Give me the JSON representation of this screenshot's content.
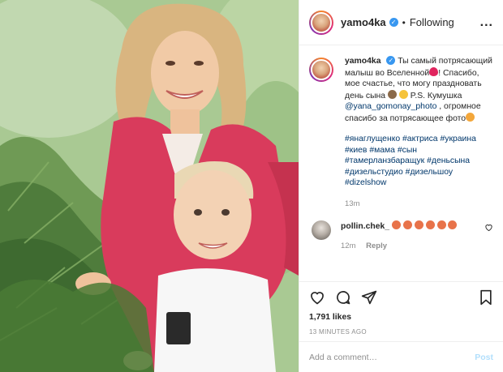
{
  "post": {
    "photo_alt": "",
    "header": {
      "username": "yamo4ka",
      "separator": "•",
      "follow_status": "Following",
      "more": "..."
    },
    "caption": {
      "username": "yamo4ka",
      "line1": "Ты самый потрясающий малыш во Вселенной",
      "line1_end": "!",
      "line2": "Спасибо, мое счастье, что могу праздновать день сына",
      "line2_end": " P.S. Кумушка ",
      "mention": "@yana_gomonay_photo",
      "line3": " , огромное спасибо за потрясающее фото",
      "hashtags": [
        "#янаглущенко",
        "#актриса",
        "#украина",
        "#киев",
        "#мама",
        "#сын",
        "#тамерланзбаращук",
        "#деньсына",
        "#дизельстудио",
        "#дизельшоу",
        "#dizelshow"
      ],
      "time": "13m"
    },
    "comment": {
      "username": "pollin.chek_",
      "time": "12m",
      "reply": "Reply"
    },
    "likes": "1,791 likes",
    "posted_ago": "13 MINUTES AGO",
    "add_comment_placeholder": "Add a comment…",
    "post_button": "Post",
    "colors": {
      "link": "#00376b",
      "verified": "#3897f0",
      "jacket": "#d93b5c",
      "post_disabled": "#b2dffc"
    },
    "icons": [
      "verified-icon",
      "more-icon",
      "heart-icon",
      "comment-icon",
      "share-icon",
      "bookmark-icon",
      "like-comment-icon"
    ]
  }
}
